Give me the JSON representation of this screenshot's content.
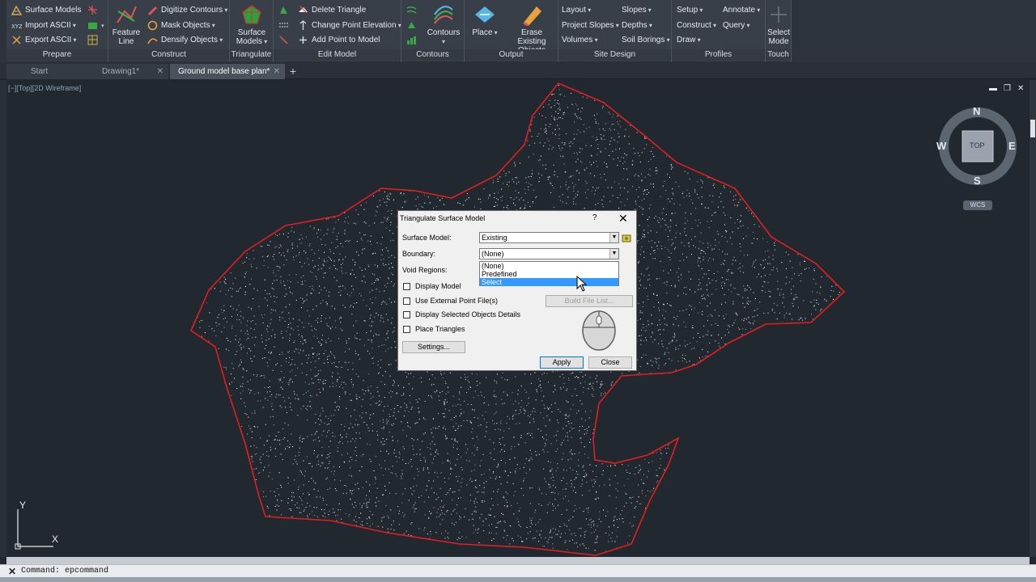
{
  "ribbon": {
    "prepare": {
      "title": "Prepare",
      "surface_models": "Surface Models",
      "import_ascii": "Import ASCII",
      "export_ascii": "Export ASCII"
    },
    "construct": {
      "title": "Construct",
      "feature_line": "Feature Line",
      "digitize_contours": "Digitize Contours",
      "mask_objects": "Mask Objects",
      "densify_objects": "Densify Objects"
    },
    "triangulate": {
      "title": "Triangulate",
      "surface_models": "Surface Models"
    },
    "edit_model": {
      "title": "Edit Model",
      "delete_triangle": "Delete Triangle",
      "change_point_elevation": "Change Point Elevation",
      "add_point": "Add Point to Model"
    },
    "contours": {
      "title": "Contours",
      "contours": "Contours"
    },
    "output": {
      "title": "Output",
      "place": "Place",
      "erase_existing": "Erase Existing Objects"
    },
    "site_design": {
      "title": "Site Design",
      "layout": "Layout",
      "slopes": "Slopes",
      "project_slopes": "Project Slopes",
      "depths": "Depths",
      "volumes": "Volumes",
      "soil_borings": "Soil Borings"
    },
    "profiles": {
      "title": "Profiles",
      "setup": "Setup",
      "annotate": "Annotate",
      "construct": "Construct",
      "query": "Query",
      "draw": "Draw"
    },
    "touch": {
      "title": "Touch",
      "select_mode": "Select Mode"
    }
  },
  "tabs": [
    {
      "label": "Start"
    },
    {
      "label": "Drawing1*"
    },
    {
      "label": "Ground model base plan*"
    }
  ],
  "viewport": {
    "label": "[−][Top][2D Wireframe]"
  },
  "viewcube": {
    "n": "N",
    "s": "S",
    "e": "E",
    "w": "W",
    "top": "TOP",
    "wcs": "WCS"
  },
  "ucs": {
    "x": "X",
    "y": "Y"
  },
  "command": {
    "text": "Command: epcommand"
  },
  "dialog": {
    "title": "Triangulate Surface Model",
    "help": "?",
    "surface_model_label": "Surface Model:",
    "surface_model_value": "Existing",
    "boundary_label": "Boundary:",
    "boundary_value": "(None)",
    "boundary_options": [
      "(None)",
      "Predefined",
      "Select"
    ],
    "boundary_highlight": "Select",
    "void_regions_label": "Void Regions:",
    "display_model": "Display Model",
    "use_external": "Use External Point File(s)",
    "build_file_list": "Build File List...",
    "display_selected": "Display Selected Objects Details",
    "place_triangles": "Place Triangles",
    "settings": "Settings...",
    "apply": "Apply",
    "close": "Close"
  },
  "colors": {
    "boundary": "#e01f1f",
    "points": "#ffffff",
    "background": "#212830",
    "highlight": "#3399ff"
  }
}
